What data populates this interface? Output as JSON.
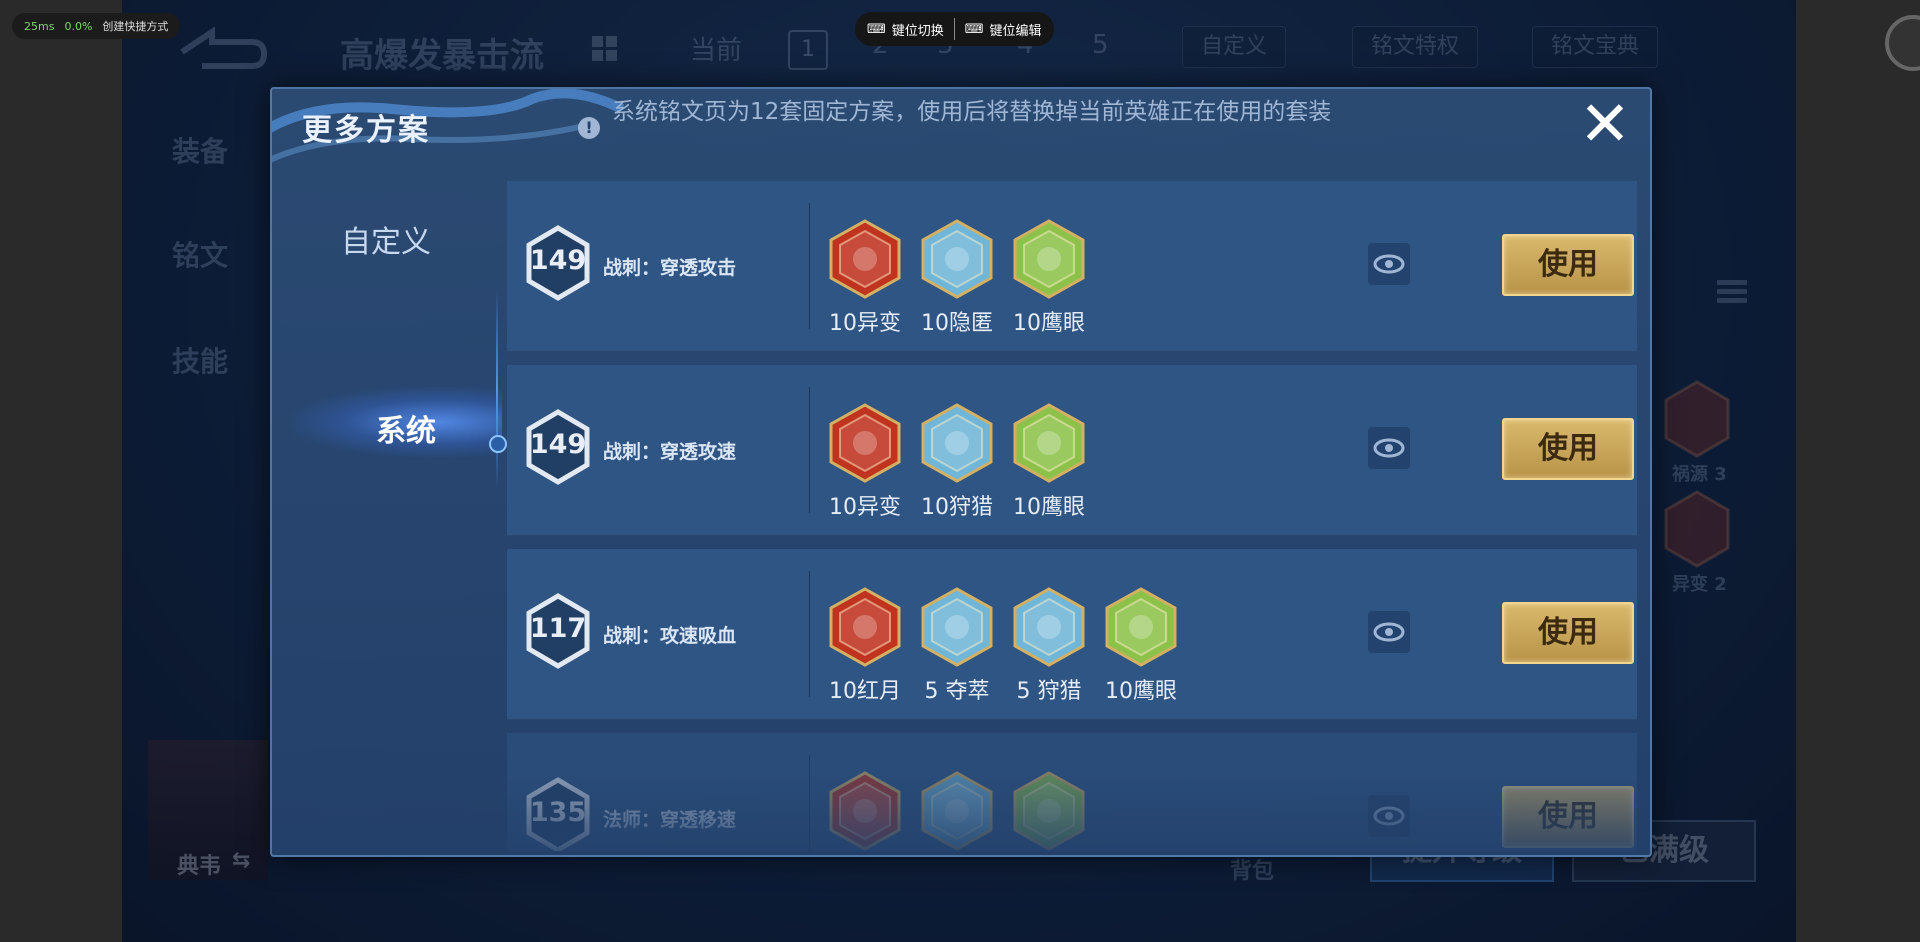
{
  "overlay": {
    "ping": "25ms",
    "loss": "0.0%",
    "shortcut_label": "创建快捷方式",
    "key_switch_label": "键位切换",
    "key_edit_label": "键位编辑"
  },
  "background": {
    "title": "高爆发暴击流",
    "current_label": "当前",
    "pages": [
      "1",
      "2",
      "3",
      "4",
      "5"
    ],
    "custom_tab": "自定义",
    "privilege_btn": "铭文特权",
    "treasure_btn": "铭文宝典",
    "left_tabs": [
      "装备",
      "铭文",
      "技能"
    ],
    "hero_name": "典韦",
    "bag_label": "背包",
    "bottom_btn_left": "提升等级",
    "bottom_btn_right": "已满级",
    "side_rune_1": "祸源 3",
    "side_rune_2": "异变 2"
  },
  "modal": {
    "title": "更多方案",
    "notice": "系统铭文页为12套固定方案，使用后将替换掉当前英雄正在使用的套装",
    "close_label": "✕",
    "sidebar": [
      {
        "label": "自定义",
        "active": false
      },
      {
        "label": "系统",
        "active": true
      }
    ],
    "use_label": "使用",
    "rows": [
      {
        "level": "149",
        "name": "战刺：穿透攻击",
        "runes": [
          {
            "label": "10异变",
            "color": "red",
            "icon": "mutation-rune-icon"
          },
          {
            "label": "10隐匿",
            "color": "blue",
            "icon": "stealth-rune-icon"
          },
          {
            "label": "10鹰眼",
            "color": "green",
            "icon": "hawkeye-rune-icon"
          }
        ]
      },
      {
        "level": "149",
        "name": "战刺：穿透攻速",
        "runes": [
          {
            "label": "10异变",
            "color": "red",
            "icon": "mutation-rune-icon"
          },
          {
            "label": "10狩猎",
            "color": "blue",
            "icon": "hunt-rune-icon"
          },
          {
            "label": "10鹰眼",
            "color": "green",
            "icon": "hawkeye-rune-icon"
          }
        ]
      },
      {
        "level": "117",
        "name": "战刺：攻速吸血",
        "runes": [
          {
            "label": "10红月",
            "color": "red",
            "icon": "red-moon-rune-icon"
          },
          {
            "label": "5 夺萃",
            "color": "blue",
            "icon": "seize-rune-icon"
          },
          {
            "label": "5 狩猎",
            "color": "blue",
            "icon": "hunt-rune-icon"
          },
          {
            "label": "10鹰眼",
            "color": "green",
            "icon": "hawkeye-rune-icon"
          }
        ]
      },
      {
        "level": "135",
        "name": "法师：穿透移速",
        "runes": [
          {
            "label": "",
            "color": "red",
            "icon": "red-rune-icon"
          },
          {
            "label": "",
            "color": "blue",
            "icon": "blue-rune-icon"
          },
          {
            "label": "",
            "color": "green",
            "icon": "green-rune-icon"
          }
        ]
      }
    ]
  },
  "colors": {
    "red": "#c0331f",
    "blue": "#6fb6d8",
    "green": "#8cc24a",
    "gold": "#d4b062"
  }
}
